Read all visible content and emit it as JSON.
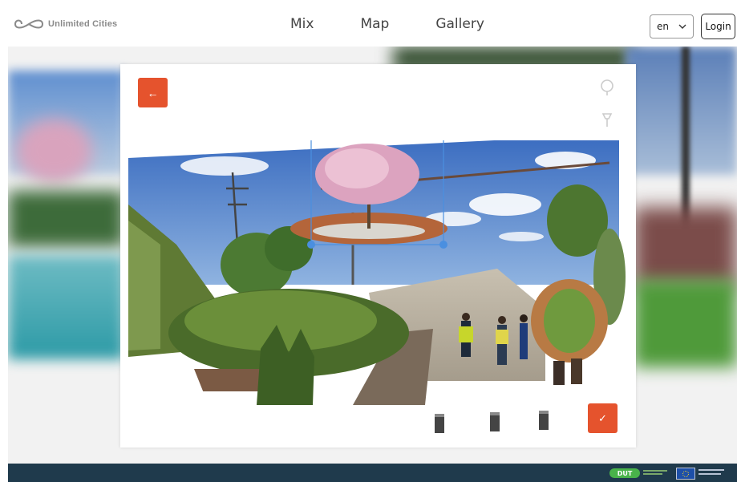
{
  "header": {
    "logo_text": "Unlimited Cities",
    "nav": [
      {
        "label": "Mix"
      },
      {
        "label": "Map"
      },
      {
        "label": "Gallery"
      }
    ],
    "language": {
      "value": "en"
    },
    "login_label": "Login"
  },
  "editor": {
    "back_icon": "arrow-left-icon",
    "confirm_icon": "check-icon",
    "tools": [
      "tree-icon",
      "lamp-icon",
      "bicycle-icon",
      "house-icon",
      "palette-icon"
    ]
  },
  "footer": {
    "dut_badge": "DUT"
  },
  "colors": {
    "accent": "#e5532d",
    "footer": "#1f3a4c",
    "selection": "#4a8fe0"
  }
}
